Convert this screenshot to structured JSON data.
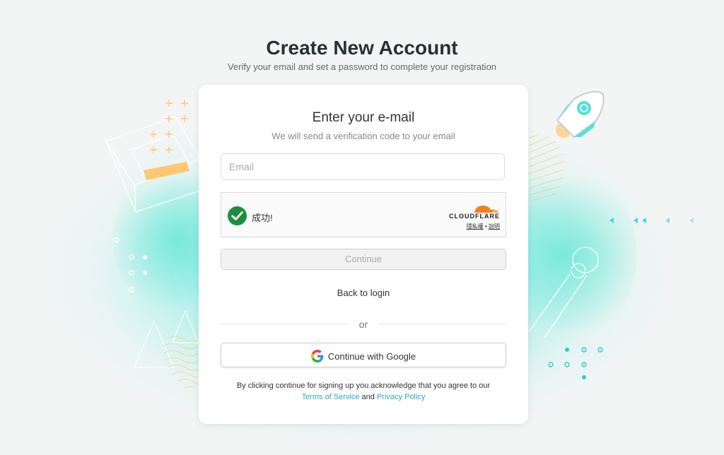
{
  "header": {
    "title": "Create New Account",
    "subtitle": "Verify your email and set a password to complete your registration"
  },
  "card": {
    "title": "Enter your e-mail",
    "subtitle": "We will send a verification code to your email",
    "email": {
      "placeholder": "Email",
      "value": ""
    },
    "captcha": {
      "status_text": "成功!",
      "brand": "CLOUDFLARE",
      "privacy_link": "隱私權",
      "separator": "•",
      "help_link": "說明"
    },
    "continue_label": "Continue",
    "back_to_login": "Back to login",
    "or_text": "or",
    "google_label": "Continue with Google",
    "terms": {
      "prefix": "By clicking continue for signing up you acknowledge that you agree to our",
      "tos": "Terms of Service",
      "and": "and",
      "privacy": "Privacy Policy"
    }
  },
  "colors": {
    "accent": "#2aa5c5",
    "glow": "#48e6dc",
    "success": "#1e8e3e",
    "cloudflare": "#f38020"
  }
}
